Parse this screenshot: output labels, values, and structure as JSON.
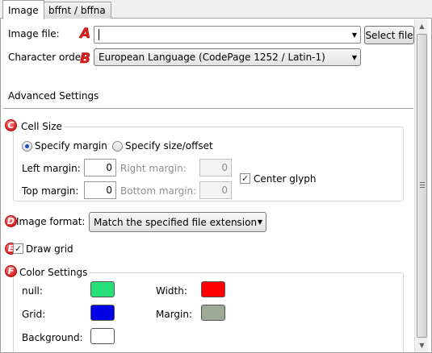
{
  "tabs": [
    {
      "label": "Image",
      "active": true
    },
    {
      "label": "bffnt / bffna",
      "active": false
    }
  ],
  "image_file": {
    "label": "Image file:",
    "value": "",
    "select_button": "Select file"
  },
  "character_order": {
    "label": "Character order:",
    "selected": "European Language (CodePage 1252 / Latin-1)"
  },
  "advanced_settings": {
    "label": "Advanced Settings"
  },
  "cell_size": {
    "title": "Cell Size",
    "mode_margin": "Specify margin",
    "mode_size": "Specify size/offset",
    "selected_mode": "Specify margin",
    "left_margin_label": "Left margin:",
    "left_margin": "0",
    "top_margin_label": "Top margin:",
    "top_margin": "0",
    "right_margin_label": "Right margin:",
    "right_margin": "0",
    "bottom_margin_label": "Bottom margin:",
    "bottom_margin": "0",
    "center_glyph_label": "Center glyph",
    "center_glyph": true
  },
  "image_format": {
    "label": "Image format:",
    "selected": "Match the specified file extension"
  },
  "draw_grid": {
    "label": "Draw grid",
    "checked": true
  },
  "color_settings": {
    "title": "Color Settings",
    "null_label": "null:",
    "null_color": "#28e07a",
    "width_label": "Width:",
    "width_color": "#ff0000",
    "grid_label": "Grid:",
    "grid_color": "#0000e6",
    "margin_label": "Margin:",
    "margin_color": "#9aaa96",
    "background_label": "Background:",
    "background_color": "#ffffff"
  },
  "annotations": {
    "a": "A",
    "b": "B",
    "c": "C",
    "d": "D",
    "e": "E",
    "f": "F"
  },
  "icons": {
    "dropdown": "chevron-down-icon",
    "check": "checkmark-icon"
  }
}
